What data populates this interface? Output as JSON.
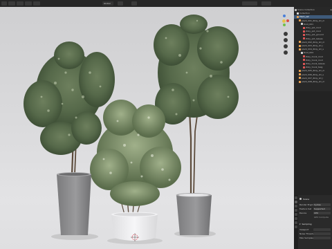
{
  "header": {
    "menus": [
      "",
      "",
      "",
      ""
    ],
    "viewport_mode": "Global",
    "top_right_label": "Scene",
    "top_right_label2": "View Layer"
  },
  "viewport": {
    "overlay_lines": [
      "",
      "",
      ""
    ],
    "cursor_color": "#e0404f",
    "pots": [
      {
        "name": "tall-pot-left",
        "color": "#8d8d8f"
      },
      {
        "name": "white-pot-center",
        "color": "#e8e8ea"
      },
      {
        "name": "grey-pot-right",
        "color": "#8a8a8c"
      }
    ]
  },
  "outliner": {
    "title": "Scene Collection",
    "rows": [
      {
        "label": "Scene Collection",
        "indent": 0,
        "icon_color": "#b8b8b8",
        "selected": false
      },
      {
        "label": "Collection",
        "indent": 1,
        "icon_color": "#d8d8d8",
        "selected": false
      },
      {
        "label": "Plant_set",
        "indent": 1,
        "icon_color": "#e9a04f",
        "selected": true
      },
      {
        "label": "plant_001_Ziziy_str_m",
        "indent": 2,
        "icon_color": "#e9a04f",
        "selected": false
      },
      {
        "label": "Root_001",
        "indent": 3,
        "icon_color": "#d0d0d0",
        "selected": false
      },
      {
        "label": "Ziziy_pot_mod",
        "indent": 4,
        "icon_color": "#dd5555",
        "selected": false
      },
      {
        "label": "Ziziy_pot_mod",
        "indent": 4,
        "icon_color": "#dd5555",
        "selected": false
      },
      {
        "label": "Ziziy_pot_ground",
        "indent": 4,
        "icon_color": "#dd5555",
        "selected": false
      },
      {
        "label": "Ziziy_pot_leaves",
        "indent": 4,
        "icon_color": "#dd5555",
        "selected": false
      },
      {
        "label": "plant_002_Ziziy_str_m",
        "indent": 2,
        "icon_color": "#e9a04f",
        "selected": false
      },
      {
        "label": "plant_003_Ziziy_str_l",
        "indent": 2,
        "icon_color": "#e9a04f",
        "selected": false
      },
      {
        "label": "plant_004_Ziziy_str_s",
        "indent": 2,
        "icon_color": "#e9a04f",
        "selected": false
      },
      {
        "label": "Root_004",
        "indent": 3,
        "icon_color": "#d0d0d0",
        "selected": false
      },
      {
        "label": "Ziziy_trunk_mod",
        "indent": 4,
        "icon_color": "#dd5555",
        "selected": false
      },
      {
        "label": "Ziziy_trunk_mod",
        "indent": 4,
        "icon_color": "#dd5555",
        "selected": false
      },
      {
        "label": "Ziziy_trunk_leaves",
        "indent": 4,
        "icon_color": "#dd5555",
        "selected": false
      },
      {
        "label": "Ziziy_trunk_twig",
        "indent": 4,
        "icon_color": "#dd5555",
        "selected": false
      },
      {
        "label": "plant_005_Ziziy_str_m",
        "indent": 2,
        "icon_color": "#e9a04f",
        "selected": false
      },
      {
        "label": "plant_006_Ziziy_str_s",
        "indent": 2,
        "icon_color": "#e9a04f",
        "selected": false
      },
      {
        "label": "plant_007_Ziziy_str_l",
        "indent": 2,
        "icon_color": "#e9a04f",
        "selected": false
      },
      {
        "label": "plant_008_Ziziy_str_m",
        "indent": 2,
        "icon_color": "#e9a04f",
        "selected": false
      }
    ]
  },
  "properties": {
    "section_title": "Scene",
    "rows": [
      {
        "label": "Render Engine",
        "value": "Cycles"
      },
      {
        "label": "Feature Set",
        "value": "Supported"
      },
      {
        "label": "Device",
        "value": "CPU"
      },
      {
        "label": "",
        "value": "GPU Compute"
      }
    ],
    "sampling_title": "Sampling",
    "sampling_rows": [
      {
        "label": "Viewport",
        "value": ""
      },
      {
        "label": "Noise Threshold",
        "value": ""
      },
      {
        "label": "Max Samples",
        "value": ""
      }
    ]
  }
}
